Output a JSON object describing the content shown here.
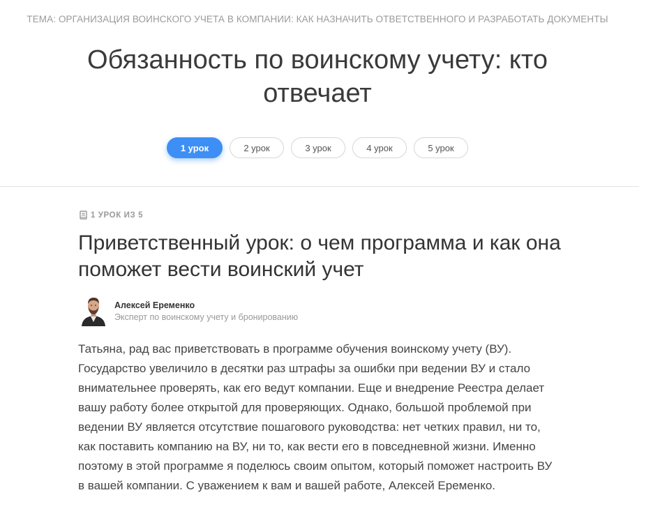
{
  "header": {
    "topic": "ТЕМА: ОРГАНИЗАЦИЯ ВОИНСКОГО УЧЕТА В КОМПАНИИ: КАК НАЗНАЧИТЬ ОТВЕТСТВЕННОГО И РАЗРАБОТАТЬ ДОКУМЕНТЫ",
    "course_title": "Обязанность по воинскому учету: кто отвечает"
  },
  "lessons": {
    "active_index": 0,
    "items": [
      {
        "label": "1 урок"
      },
      {
        "label": "2 урок"
      },
      {
        "label": "3 урок"
      },
      {
        "label": "4 урок"
      },
      {
        "label": "5 урок"
      }
    ]
  },
  "lesson": {
    "counter_icon": "book-icon",
    "counter": "1 УРОК ИЗ 5",
    "title": "Приветственный урок: о чем программа и как она поможет вести воинский учет",
    "author": {
      "name": "Алексей Еременко",
      "role": "Эксперт по воинскому учету и бронированию"
    },
    "body": "Татьяна, рад вас приветствовать в программе обучения воинскому учету (ВУ). Государство увеличило в десятки раз штрафы за ошибки при ведении ВУ и стало внимательнее проверять, как его ведут компании. Еще и внедрение Реестра делает вашу работу более открытой для проверяющих. Однако, большой проблемой при ведении ВУ является отсутствие пошагового руководства: нет четких правил, ни то, как поставить компанию на ВУ, ни то, как вести его в повседневной жизни. Именно поэтому в этой программе я поделюсь своим опытом, который поможет настроить ВУ в вашей компании. С уважением к вам и вашей работе, Алексей Еременко."
  },
  "colors": {
    "accent": "#3d8ff5",
    "muted_text": "#9a9a9a",
    "divider": "#e4e4e4"
  }
}
